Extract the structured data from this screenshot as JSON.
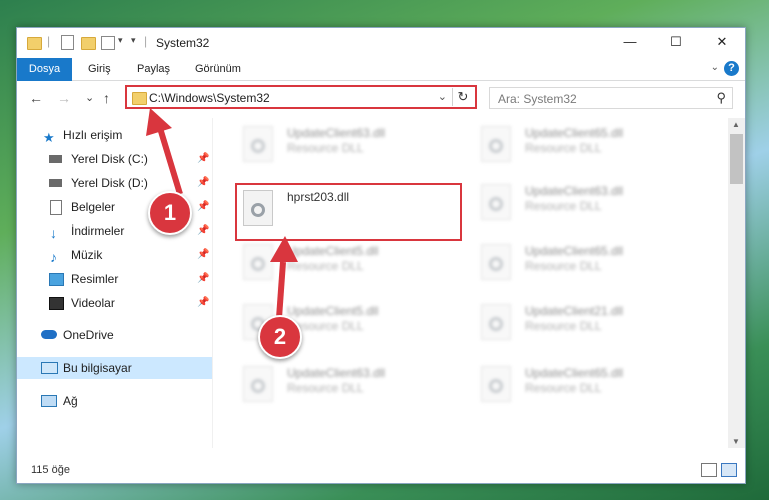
{
  "window": {
    "title": "System32",
    "controls": {
      "minimize": "—",
      "maximize": "☐",
      "close": "✕"
    }
  },
  "ribbon": {
    "tabs": [
      "Dosya",
      "Giriş",
      "Paylaş",
      "Görünüm"
    ],
    "help_label": "?"
  },
  "nav": {
    "back": "←",
    "forward": "→",
    "recent": "⌄",
    "up": "↑",
    "address": "C:\\Windows\\System32",
    "refresh": "↻",
    "search_placeholder": "Ara: System32"
  },
  "sidebar": {
    "items": [
      {
        "label": "Hızlı erişim",
        "icon": "star-icon",
        "pinned": false
      },
      {
        "label": "Yerel Disk (C:)",
        "icon": "drive-icon",
        "pinned": true
      },
      {
        "label": "Yerel Disk (D:)",
        "icon": "drive-icon",
        "pinned": true
      },
      {
        "label": "Belgeler",
        "icon": "documents-icon",
        "pinned": true
      },
      {
        "label": "İndirmeler",
        "icon": "download-icon",
        "pinned": true
      },
      {
        "label": "Müzik",
        "icon": "music-icon",
        "pinned": true
      },
      {
        "label": "Resimler",
        "icon": "pictures-icon",
        "pinned": true
      },
      {
        "label": "Videolar",
        "icon": "videos-icon",
        "pinned": true
      },
      {
        "label": "OneDrive",
        "icon": "cloud-icon",
        "pinned": false
      },
      {
        "label": "Bu bilgisayar",
        "icon": "computer-icon",
        "pinned": false
      },
      {
        "label": "Ağ",
        "icon": "network-icon",
        "pinned": false
      }
    ]
  },
  "files": [
    {
      "name": "UpdateClient63.dll",
      "type": "Resource DLL"
    },
    {
      "name": "UpdateClient65.dll",
      "type": "Resource DLL"
    },
    {
      "name": "hprst203.dll",
      "type": ""
    },
    {
      "name": "UpdateClient63.dll",
      "type": "Resource DLL"
    },
    {
      "name": "UpdateClient5.dll",
      "type": "Resource DLL"
    },
    {
      "name": "UpdateClient65.dll",
      "type": "Resource DLL"
    },
    {
      "name": "UpdateClient5.dll",
      "type": "Resource DLL"
    },
    {
      "name": "UpdateClient21.dll",
      "type": "Resource DLL"
    },
    {
      "name": "UpdateClient63.dll",
      "type": "Resource DLL"
    },
    {
      "name": "UpdateClient65.dll",
      "type": "Resource DLL"
    }
  ],
  "status": {
    "item_count": "115 öğe"
  },
  "annotations": {
    "step1": "1",
    "step2": "2"
  },
  "colors": {
    "accent": "#1979ca",
    "highlight": "#d9363e",
    "selected": "#cce8ff"
  }
}
